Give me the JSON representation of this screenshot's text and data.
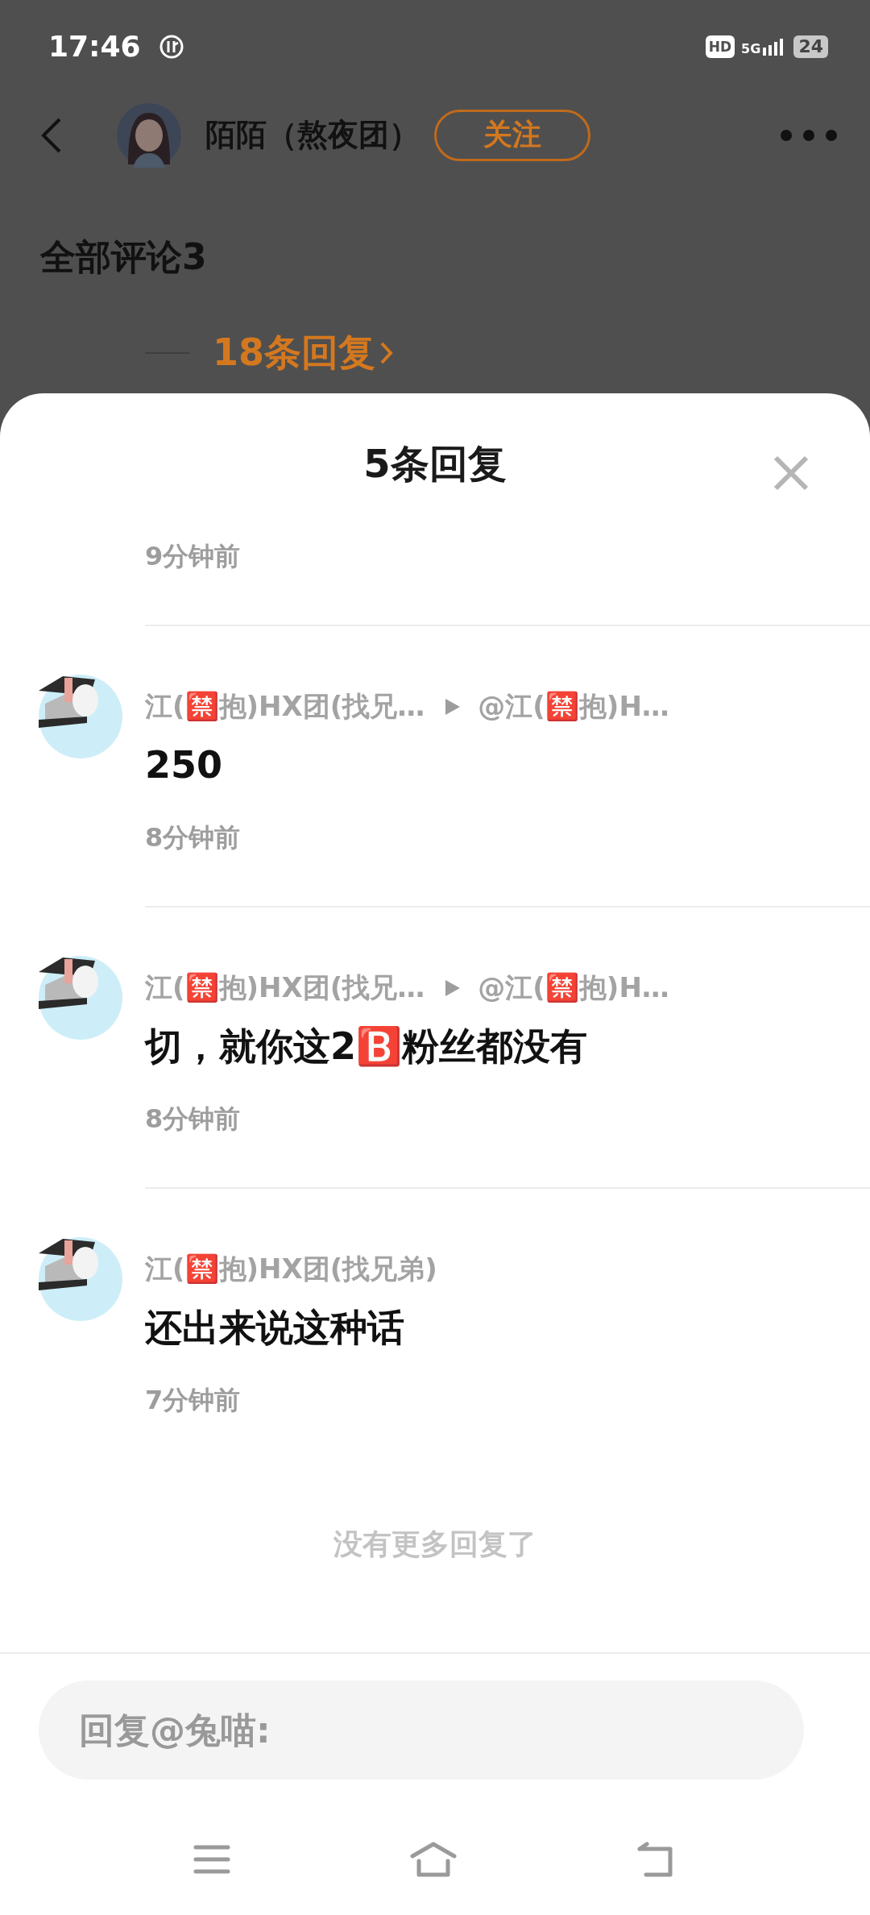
{
  "status_bar": {
    "time": "17:46",
    "hd": "HD",
    "network": "5G",
    "battery": "24"
  },
  "header": {
    "user_name": "陌陌（熬夜团）",
    "follow_button": "关注",
    "section_title": "全部评论3",
    "replies_link": "18条回复"
  },
  "sheet": {
    "title": "5条回复",
    "partial_time": "9分钟前",
    "replies": [
      {
        "name": "江(🈲抱)HX团(找兄…",
        "reply_to": "@江(🈲抱)H…",
        "content": "250",
        "time": "8分钟前"
      },
      {
        "name": "江(🈲抱)HX团(找兄…",
        "reply_to": "@江(🈲抱)H…",
        "content": "切，就你这2🅱️粉丝都没有",
        "time": "8分钟前"
      },
      {
        "name": "江(🈲抱)HX团(找兄弟)",
        "content": "还出来说这种话",
        "time": "7分钟前"
      }
    ],
    "end_note": "没有更多回复了"
  },
  "input": {
    "placeholder": "回复@兔喵:"
  }
}
